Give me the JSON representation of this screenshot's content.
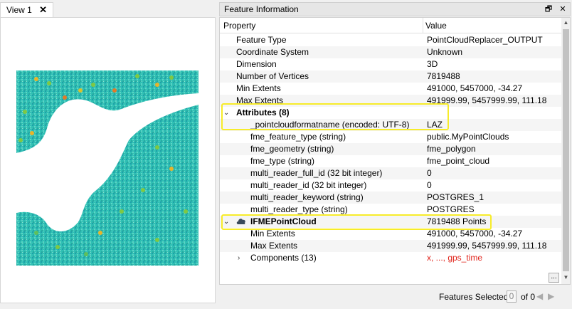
{
  "view": {
    "tab_label": "View 1",
    "close_glyph": "✕"
  },
  "panel": {
    "title": "Feature Information",
    "float_glyph": "🗗",
    "close_glyph": "✕",
    "col_property": "Property",
    "col_value": "Value"
  },
  "rows": [
    {
      "k": "Feature Type",
      "v": "PointCloudReplacer_OUTPUT"
    },
    {
      "k": "Coordinate System",
      "v": "Unknown"
    },
    {
      "k": "Dimension",
      "v": "3D"
    },
    {
      "k": "Number of Vertices",
      "v": "7819488"
    },
    {
      "k": "Min Extents",
      "v": "491000, 5457000, -34.27"
    },
    {
      "k": "Max Extents",
      "v": "491999.99, 5457999.99, 111.18"
    },
    {
      "k": "Attributes (8)",
      "v": ""
    },
    {
      "k": "_pointcloudformatname (encoded: UTF-8)",
      "v": "LAZ"
    },
    {
      "k": "fme_feature_type (string)",
      "v": "public.MyPointClouds"
    },
    {
      "k": "fme_geometry (string)",
      "v": "fme_polygon"
    },
    {
      "k": "fme_type (string)",
      "v": "fme_point_cloud"
    },
    {
      "k": "multi_reader_full_id (32 bit integer)",
      "v": "0"
    },
    {
      "k": "multi_reader_id (32 bit integer)",
      "v": "0"
    },
    {
      "k": "multi_reader_keyword (string)",
      "v": "POSTGRES_1"
    },
    {
      "k": "multi_reader_type (string)",
      "v": "POSTGRES"
    },
    {
      "k": "IFMEPointCloud",
      "v": "7819488 Points"
    },
    {
      "k": "Min Extents",
      "v": "491000, 5457000, -34.27"
    },
    {
      "k": "Max Extents",
      "v": "491999.99, 5457999.99, 111.18"
    },
    {
      "k": "Components (13)",
      "v": "x, ..., gps_time"
    }
  ],
  "ellipsis": "...",
  "footer": {
    "label": "Features Selected:",
    "count": "0",
    "of": "of 0",
    "prev": "◀",
    "next": "▶"
  },
  "colors": {
    "highlight": "#f7ec2a",
    "component_value": "#e0241b"
  }
}
